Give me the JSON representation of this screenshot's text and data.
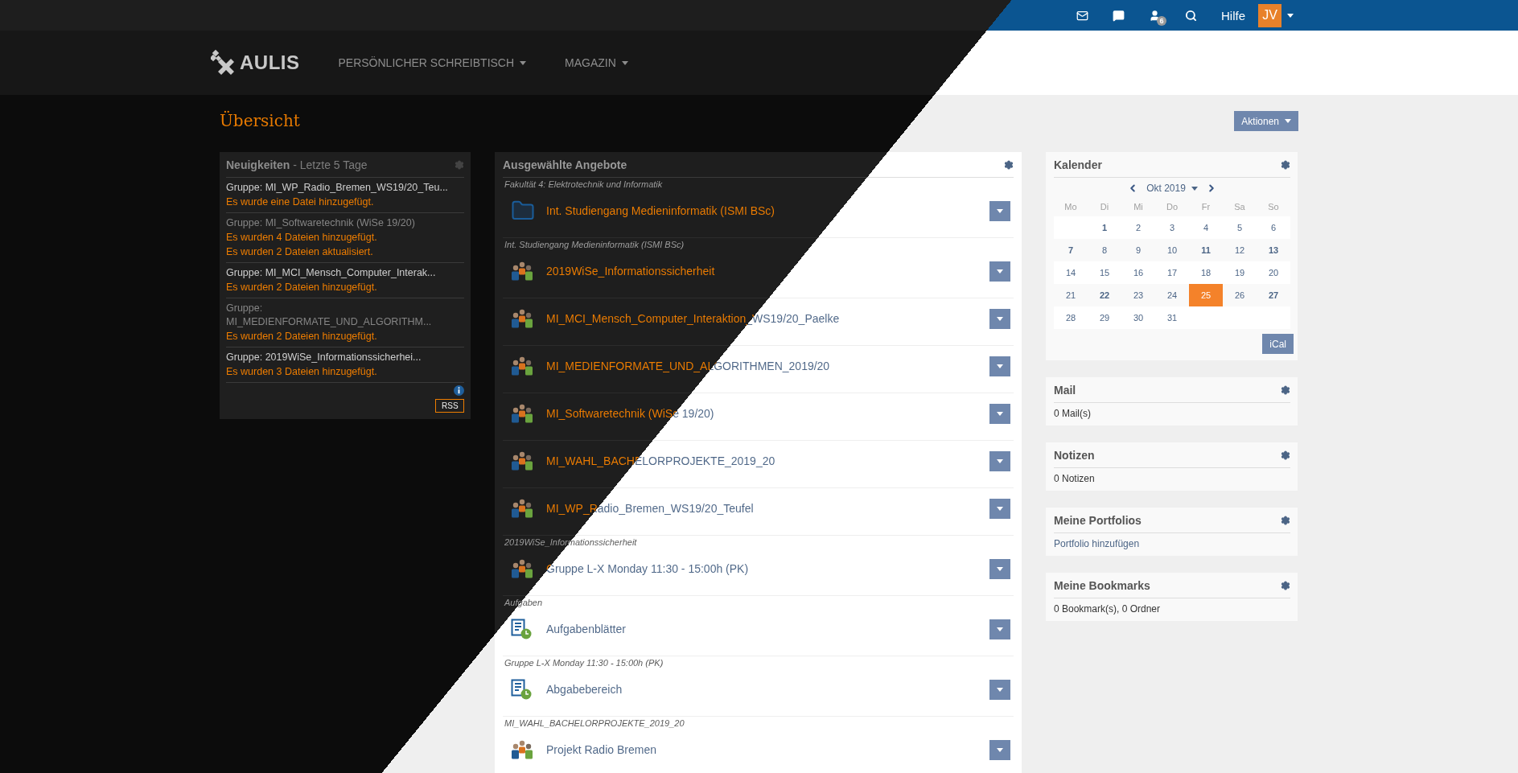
{
  "top_bar": {
    "user_badge": "6",
    "help": "Hilfe",
    "avatar": "JV"
  },
  "header": {
    "logo": "AULIS",
    "nav": [
      "PERSÖNLICHER SCHREIBTISCH",
      "MAGAZIN"
    ]
  },
  "page": {
    "title": "Übersicht",
    "actions_button": "Aktionen"
  },
  "news": {
    "title": "**Neuigkeiten** - Letzte 5 Tage",
    "entries": [
      {
        "group": "Gruppe: MI_WP_Radio_Bremen_WS19/20_Teu...",
        "seen": false,
        "messages": [
          "Es wurde eine Datei hinzugefügt."
        ]
      },
      {
        "group": "Gruppe: MI_Softwaretechnik (WiSe 19/20)",
        "seen": true,
        "messages": [
          "Es wurden 4 Dateien hinzugefügt.",
          "Es wurden 2 Dateien aktualisiert."
        ]
      },
      {
        "group": "Gruppe: MI_MCI_Mensch_Computer_Interak...",
        "seen": false,
        "messages": [
          "Es wurden 2 Dateien hinzugefügt."
        ]
      },
      {
        "group": "Gruppe: MI_MEDIENFORMATE_UND_ALGORITHM...",
        "seen": true,
        "messages": [
          "Es wurden 2 Dateien hinzugefügt."
        ]
      },
      {
        "group": "Gruppe: 2019WiSe_Informationssicherhei...",
        "seen": false,
        "messages": [
          "Es wurden 3 Dateien hinzugefügt."
        ]
      }
    ],
    "rss": "RSS"
  },
  "selected_items": {
    "title": "Ausgewählte Angebote",
    "groups": [
      {
        "label": "Fakultät 4: Elektrotechnik und Informatik",
        "items": [
          {
            "kind": "category",
            "title": "Int. Studiengang Medieninformatik (ISMI BSc)"
          }
        ]
      },
      {
        "label": "Int. Studiengang Medieninformatik (ISMI BSc)",
        "items": [
          {
            "kind": "group",
            "title": "2019WiSe_Informationssicherheit"
          },
          {
            "kind": "group",
            "title": "MI_MCI_Mensch_Computer_Interaktion_WS19/20_Paelke"
          },
          {
            "kind": "group",
            "title": "MI_MEDIENFORMATE_UND_ALGORITHMEN_2019/20"
          },
          {
            "kind": "group",
            "title": "MI_Softwaretechnik (WiSe 19/20)"
          },
          {
            "kind": "group",
            "title": "MI_WAHL_BACHELORPROJEKTE_2019_20"
          },
          {
            "kind": "group",
            "title": "MI_WP_Radio_Bremen_WS19/20_Teufel"
          }
        ]
      },
      {
        "label": "2019WiSe_Informationssicherheit",
        "items": [
          {
            "kind": "group",
            "title": "Gruppe L-X Monday 11:30 - 15:00h (PK)"
          }
        ]
      },
      {
        "label": "Aufgaben",
        "items": [
          {
            "kind": "exercise",
            "title": "Aufgabenblätter"
          }
        ]
      },
      {
        "label": "Gruppe L-X Monday 11:30 - 15:00h (PK)",
        "items": [
          {
            "kind": "exercise",
            "title": "Abgabebereich"
          }
        ]
      },
      {
        "label": "MI_WAHL_BACHELORPROJEKTE_2019_20",
        "items": [
          {
            "kind": "group",
            "title": "Projekt Radio Bremen"
          }
        ]
      }
    ]
  },
  "calendar": {
    "title": "Kalender",
    "month": "Okt 2019",
    "weekdays": [
      "Mo",
      "Di",
      "Mi",
      "Do",
      "Fr",
      "Sa",
      "So"
    ],
    "weeks": [
      [
        {
          "kind": "empty"
        },
        {
          "day": "1",
          "bold": true,
          "selected": false
        },
        {
          "day": "2",
          "bold": false,
          "selected": false
        },
        {
          "day": "3",
          "bold": false,
          "selected": false
        },
        {
          "day": "4",
          "bold": false,
          "selected": false
        },
        {
          "day": "5",
          "bold": false,
          "selected": false
        },
        {
          "day": "6",
          "bold": false,
          "selected": false
        }
      ],
      [
        {
          "day": "7",
          "bold": true,
          "selected": false
        },
        {
          "day": "8",
          "bold": false,
          "selected": false
        },
        {
          "day": "9",
          "bold": false,
          "selected": false
        },
        {
          "day": "10",
          "bold": false,
          "selected": false
        },
        {
          "day": "11",
          "bold": true,
          "selected": false
        },
        {
          "day": "12",
          "bold": false,
          "selected": false
        },
        {
          "day": "13",
          "bold": true,
          "selected": false
        }
      ],
      [
        {
          "day": "14",
          "bold": false,
          "selected": false
        },
        {
          "day": "15",
          "bold": false,
          "selected": false
        },
        {
          "day": "16",
          "bold": false,
          "selected": false
        },
        {
          "day": "17",
          "bold": false,
          "selected": false
        },
        {
          "day": "18",
          "bold": false,
          "selected": false
        },
        {
          "day": "19",
          "bold": false,
          "selected": false
        },
        {
          "day": "20",
          "bold": false,
          "selected": false
        }
      ],
      [
        {
          "day": "21",
          "bold": false,
          "selected": false
        },
        {
          "day": "22",
          "bold": true,
          "selected": false
        },
        {
          "day": "23",
          "bold": false,
          "selected": false
        },
        {
          "day": "24",
          "bold": false,
          "selected": false
        },
        {
          "day": "25",
          "bold": false,
          "selected": true
        },
        {
          "day": "26",
          "bold": false,
          "selected": false
        },
        {
          "day": "27",
          "bold": true,
          "selected": false
        }
      ],
      [
        {
          "day": "28",
          "bold": false,
          "selected": false
        },
        {
          "day": "29",
          "bold": false,
          "selected": false
        },
        {
          "day": "30",
          "bold": false,
          "selected": false
        },
        {
          "day": "31",
          "bold": false,
          "selected": false
        }
      ]
    ],
    "ical": "iCal"
  },
  "widgets": [
    {
      "title": "Mail",
      "kind": "text",
      "text": "0 Mail(s)"
    },
    {
      "title": "Notizen",
      "kind": "text",
      "text": "0 Notizen"
    },
    {
      "title": "Meine Portfolios",
      "kind": "link",
      "text": "Portfolio hinzufügen"
    },
    {
      "title": "Meine Bookmarks",
      "kind": "text",
      "text": "0 Bookmark(s), 0 Ordner"
    }
  ]
}
